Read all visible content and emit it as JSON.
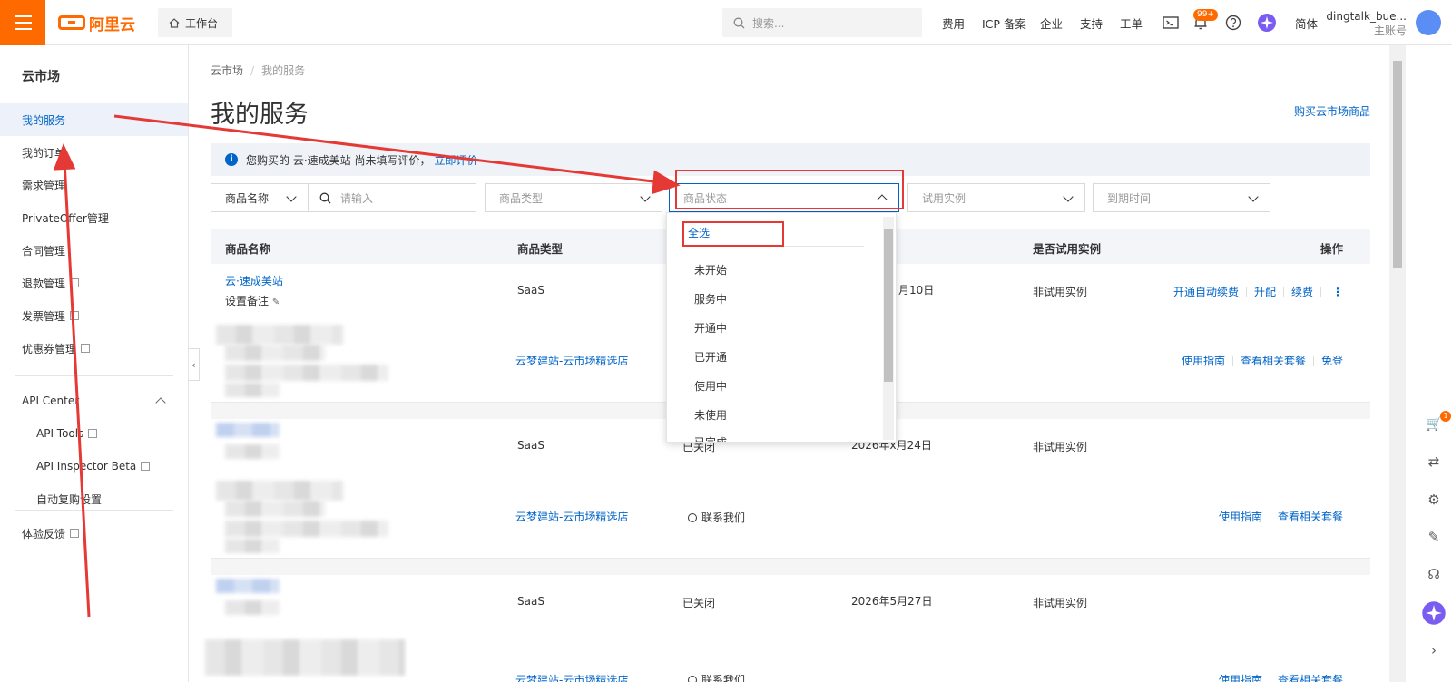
{
  "header": {
    "logo_text": "阿里云",
    "workbench_label": "工作台",
    "search_placeholder": "搜索...",
    "nav": [
      "费用",
      "ICP 备案",
      "企业",
      "支持",
      "工单"
    ],
    "notification_badge": "99+",
    "language": "简体",
    "username": "dingtalk_bue...",
    "account_type": "主账号"
  },
  "sidebar": {
    "title": "云市场",
    "items": [
      {
        "label": "我的服务",
        "active": true
      },
      {
        "label": "我的订单"
      },
      {
        "label": "需求管理"
      },
      {
        "label": "PrivateOffer管理"
      },
      {
        "label": "合同管理"
      },
      {
        "label": "退款管理",
        "external": true
      },
      {
        "label": "发票管理",
        "external": true
      },
      {
        "label": "优惠券管理",
        "external": true
      }
    ],
    "group": {
      "label": "API Center",
      "children": [
        {
          "label": "API Tools",
          "external": true
        },
        {
          "label": "API Inspector Beta",
          "external": true
        },
        {
          "label": "自动复购设置"
        }
      ]
    },
    "feedback": "体验反馈"
  },
  "breadcrumb": [
    "云市场",
    "我的服务"
  ],
  "page_title": "我的服务",
  "buy_link": "购买云市场商品",
  "notice": {
    "text": "您购买的 云·速成美站 尚未填写评价，",
    "link": "立即评价"
  },
  "filters": {
    "name_select": "商品名称",
    "name_placeholder": "请输入",
    "type_placeholder": "商品类型",
    "status_placeholder": "商品状态",
    "trial_placeholder": "试用实例",
    "expire_placeholder": "到期时间"
  },
  "table": {
    "headers": {
      "name": "商品名称",
      "type": "商品类型",
      "trial": "是否试用实例",
      "actions": "操作"
    },
    "rows": [
      {
        "name": "云·速成美站",
        "note": "设置备注",
        "type": "SaaS",
        "expire": "月10日",
        "trial": "非试用实例",
        "actions": [
          "开通自动续费",
          "升配",
          "续费"
        ]
      },
      {
        "type": "云梦建站-云市场精选店",
        "actions": [
          "使用指南",
          "查看相关套餐",
          "免登"
        ]
      },
      {
        "type": "SaaS",
        "status": "已关闭",
        "expire": "2026年x月24日",
        "trial": "非试用实例"
      },
      {
        "type": "云梦建站-云市场精选店",
        "status": "联系我们",
        "actions": [
          "使用指南",
          "查看相关套餐"
        ]
      },
      {
        "type": "SaaS",
        "status": "已关闭",
        "expire": "2026年5月27日",
        "trial": "非试用实例"
      },
      {
        "type": "云梦建站-云市场精选店",
        "status": "联系我们",
        "actions": [
          "使用指南",
          "查看相关套餐"
        ]
      }
    ]
  },
  "status_dropdown": {
    "select_all": "全选",
    "options": [
      "未开始",
      "服务中",
      "开通中",
      "已开通",
      "使用中",
      "未使用",
      "已完成"
    ]
  },
  "right_toolbar": {
    "cart_badge": "1"
  },
  "colors": {
    "brand": "#ff6a00",
    "link": "#0064c8",
    "annotation": "#e53935"
  }
}
